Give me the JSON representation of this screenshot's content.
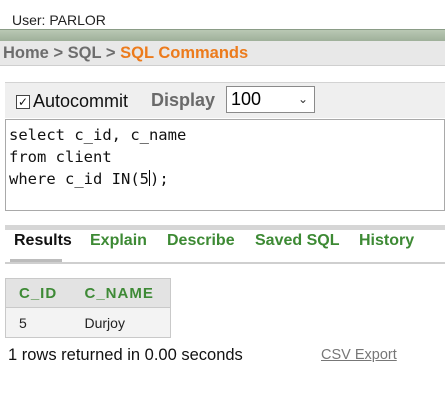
{
  "header": {
    "user_text": "User: PARLOR"
  },
  "breadcrumb": {
    "home": "Home",
    "separator": ">",
    "sql": "SQL",
    "current": "SQL Commands"
  },
  "toolbar": {
    "autocommit_label": "Autocommit",
    "autocommit_checked": true,
    "display_label": "Display",
    "display_value": "100"
  },
  "editor": {
    "lines": [
      "select c_id, c_name",
      "from client",
      "where c_id IN(5"
    ],
    "line3_after_caret": ");"
  },
  "tabs": [
    {
      "label": "Results",
      "active": true
    },
    {
      "label": "Explain",
      "active": false
    },
    {
      "label": "Describe",
      "active": false
    },
    {
      "label": "Saved SQL",
      "active": false
    },
    {
      "label": "History",
      "active": false
    }
  ],
  "results": {
    "columns": [
      "C_ID",
      "C_NAME"
    ],
    "rows": [
      [
        "5",
        "Durjoy"
      ]
    ]
  },
  "footer": {
    "rows_info": "1 rows returned in 0.00 seconds",
    "csv_export": "CSV Export"
  },
  "colors": {
    "accent_orange": "#ec7b1c",
    "tab_green": "#3d8a34"
  }
}
